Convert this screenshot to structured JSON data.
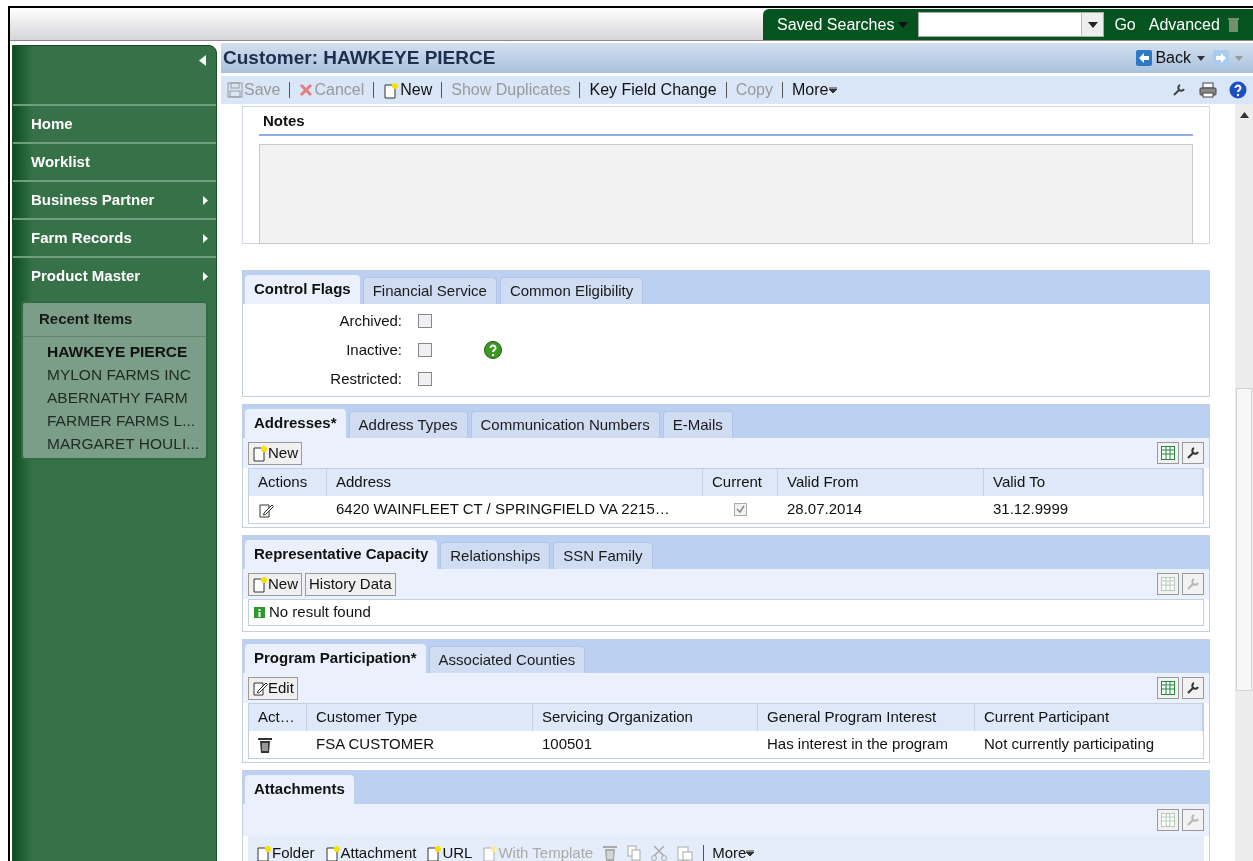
{
  "topbar": {
    "saved_searches": "Saved Searches",
    "go": "Go",
    "advanced": "Advanced"
  },
  "title": "Customer: HAWKEYE PIERCE",
  "nav": {
    "back": "Back"
  },
  "toolbar": [
    {
      "label": "Save",
      "kind": "save",
      "disabled": true
    },
    {
      "label": "Cancel",
      "kind": "cancel",
      "disabled": true
    },
    {
      "label": "New",
      "kind": "new",
      "disabled": false
    },
    {
      "label": "Show Duplicates",
      "kind": "plain",
      "disabled": true
    },
    {
      "label": "Key Field Change",
      "kind": "plain",
      "disabled": false
    },
    {
      "label": "Copy",
      "kind": "plain",
      "disabled": true
    },
    {
      "label": "More",
      "kind": "more",
      "disabled": false
    }
  ],
  "sidebar": {
    "items": [
      {
        "label": "Home",
        "submenu": false
      },
      {
        "label": "Worklist",
        "submenu": false
      },
      {
        "label": "Business Partner",
        "submenu": true
      },
      {
        "label": "Farm Records",
        "submenu": true
      },
      {
        "label": "Product Master",
        "submenu": true
      }
    ],
    "recent": {
      "title": "Recent Items",
      "items": [
        {
          "label": "HAWKEYE PIERCE",
          "selected": true
        },
        {
          "label": "MYLON FARMS INC",
          "selected": false
        },
        {
          "label": "ABERNATHY FARM",
          "selected": false
        },
        {
          "label": "FARMER FARMS L...",
          "selected": false
        },
        {
          "label": "MARGARET HOULI...",
          "selected": false
        }
      ]
    }
  },
  "notes": {
    "title": "Notes"
  },
  "sections": [
    {
      "kind": "flags",
      "tabs": [
        {
          "label": "Control Flags",
          "selected": true
        },
        {
          "label": "Financial Service",
          "selected": false
        },
        {
          "label": "Common Eligibility",
          "selected": false
        }
      ],
      "flags": [
        {
          "label": "Archived:",
          "checked": false,
          "help": false
        },
        {
          "label": "Inactive:",
          "checked": false,
          "help": true
        },
        {
          "label": "Restricted:",
          "checked": false,
          "help": false
        }
      ]
    },
    {
      "kind": "table",
      "tabs": [
        {
          "label": "Addresses*",
          "selected": true
        },
        {
          "label": "Address Types",
          "selected": false
        },
        {
          "label": "Communication Numbers",
          "selected": false
        },
        {
          "label": "E-Mails",
          "selected": false
        }
      ],
      "buttons": [
        {
          "label": "New",
          "kind": "new"
        }
      ],
      "tools_disabled": false,
      "columns": [
        "Actions",
        "Address",
        "Current",
        "Valid From",
        "Valid To"
      ],
      "rows": [
        [
          {
            "kind": "edit"
          },
          {
            "kind": "text",
            "text": "6420 WAINFLEET CT / SPRINGFIELD VA 2215…"
          },
          {
            "kind": "check",
            "checked": true
          },
          {
            "kind": "text",
            "text": "28.07.2014"
          },
          {
            "kind": "text",
            "text": "31.12.9999"
          }
        ]
      ]
    },
    {
      "kind": "message",
      "tabs": [
        {
          "label": "Representative Capacity",
          "selected": true
        },
        {
          "label": "Relationships",
          "selected": false
        },
        {
          "label": "SSN Family",
          "selected": false
        }
      ],
      "buttons": [
        {
          "label": "New",
          "kind": "new"
        },
        {
          "label": "History Data",
          "kind": "plain"
        }
      ],
      "tools_disabled": true,
      "message": "No result found"
    },
    {
      "kind": "table",
      "tabs": [
        {
          "label": "Program Participation*",
          "selected": true
        },
        {
          "label": "Associated Counties",
          "selected": false
        }
      ],
      "buttons": [
        {
          "label": "Edit",
          "kind": "edit"
        }
      ],
      "tools_disabled": false,
      "columns": [
        "Act…",
        "Customer Type",
        "Servicing Organization",
        "General Program Interest",
        "Current Participant"
      ],
      "rows": [
        [
          {
            "kind": "trash"
          },
          {
            "kind": "text",
            "text": "FSA CUSTOMER"
          },
          {
            "kind": "text",
            "text": "100501"
          },
          {
            "kind": "text",
            "text": "Has interest in the program"
          },
          {
            "kind": "text",
            "text": "Not currently participating"
          }
        ]
      ]
    },
    {
      "kind": "attachments",
      "tabs": [
        {
          "label": "Attachments",
          "selected": true
        }
      ],
      "tools_disabled": true,
      "actions": [
        {
          "label": "Folder",
          "kind": "new",
          "disabled": false
        },
        {
          "label": "Attachment",
          "kind": "new",
          "disabled": false
        },
        {
          "label": "URL",
          "kind": "new",
          "disabled": false
        },
        {
          "label": "With Template",
          "kind": "new",
          "disabled": true
        },
        {
          "kind": "trash",
          "disabled": true
        },
        {
          "kind": "copy",
          "disabled": true
        },
        {
          "kind": "cut",
          "disabled": true
        },
        {
          "kind": "paste",
          "disabled": true
        },
        {
          "label": "More",
          "kind": "more",
          "disabled": false
        }
      ]
    }
  ]
}
